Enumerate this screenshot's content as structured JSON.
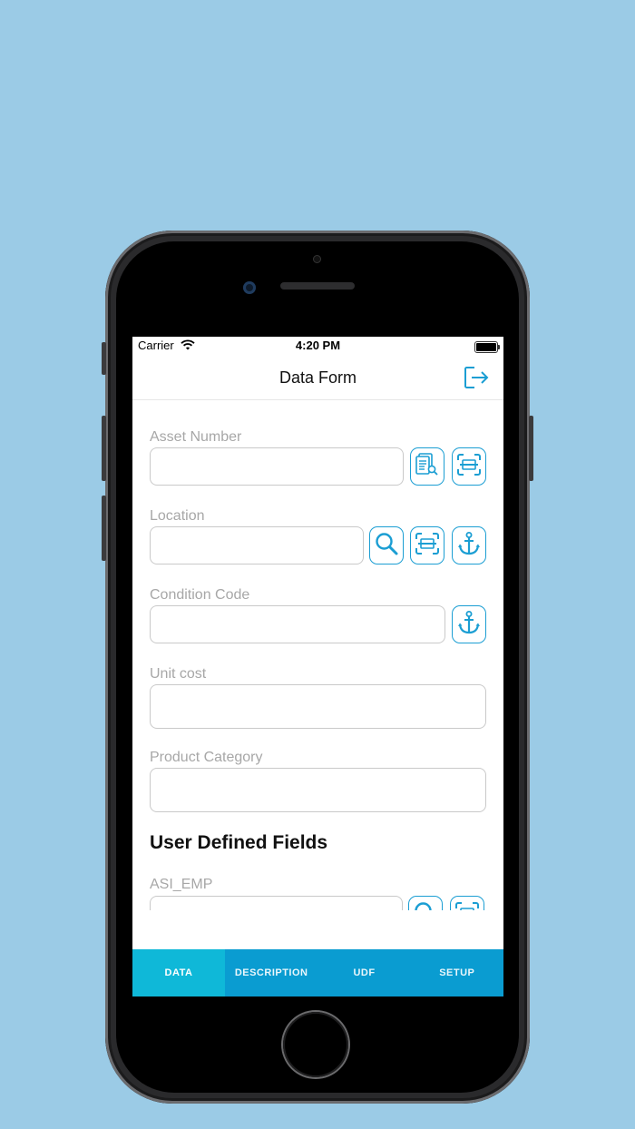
{
  "status_bar": {
    "carrier": "Carrier",
    "time": "4:20 PM"
  },
  "navbar": {
    "title": "Data Form",
    "logout_icon": "logout-icon"
  },
  "form": {
    "asset_number": {
      "label": "Asset Number",
      "value": "",
      "buttons": [
        "document-search-icon",
        "scan-icon"
      ]
    },
    "location": {
      "label": "Location",
      "value": "",
      "buttons": [
        "search-icon",
        "scan-icon",
        "anchor-icon"
      ]
    },
    "condition_code": {
      "label": "Condition Code",
      "value": "",
      "buttons": [
        "anchor-icon"
      ]
    },
    "unit_cost": {
      "label": "Unit cost",
      "value": ""
    },
    "product_category": {
      "label": "Product Category",
      "value": ""
    }
  },
  "udf_section": {
    "title": "User Defined Fields",
    "asi_emp": {
      "label": "ASI_EMP",
      "value": ""
    }
  },
  "tabs": [
    {
      "label": "DATA",
      "active": true
    },
    {
      "label": "DESCRIPTION",
      "active": false
    },
    {
      "label": "UDF",
      "active": false
    },
    {
      "label": "SETUP",
      "active": false
    }
  ],
  "colors": {
    "accent": "#1b9ed3",
    "tab_bar": "#0a9cd1",
    "tab_active": "#0fb8d8",
    "background": "#9bcbe6"
  }
}
